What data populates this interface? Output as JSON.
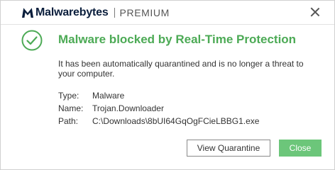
{
  "window": {
    "brand_name": "Malwarebytes",
    "edition": "PREMIUM",
    "close_icon": "close-icon"
  },
  "notification": {
    "status_icon": "check-circle-icon",
    "headline": "Malware blocked by Real-Time Protection",
    "description": "It has been automatically quarantined and is no longer a threat to your computer.",
    "details": [
      {
        "label": "Type:",
        "value": "Malware"
      },
      {
        "label": "Name:",
        "value": "Trojan.Downloader"
      },
      {
        "label": "Path:",
        "value": "C:\\Downloads\\8bUI64GqOgFCieLBBG1.exe"
      }
    ]
  },
  "actions": {
    "view_quarantine": "View Quarantine",
    "close": "Close"
  },
  "colors": {
    "accent_green": "#4caa55",
    "button_green": "#6cc67a",
    "brand_navy": "#0a1e3c"
  }
}
